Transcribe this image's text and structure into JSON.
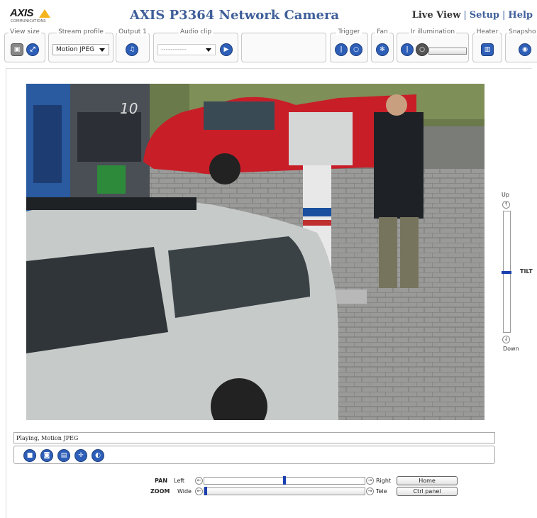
{
  "header": {
    "logo_text": "AXIS",
    "logo_sub": "COMMUNICATIONS",
    "title": "AXIS P3364 Network Camera",
    "nav": [
      "Live View",
      "Setup",
      "Help"
    ]
  },
  "toolbar": {
    "view_size_label": "View size",
    "stream_profile_label": "Stream profile",
    "stream_profile_value": "Motion JPEG",
    "output_label": "Output 1",
    "audio_clip_label": "Audio clip",
    "audio_clip_value": "-----------",
    "trigger_label": "Trigger",
    "fan_label": "Fan",
    "ir_label": "Ir illumination",
    "heater_label": "Heater",
    "snapshot_label": "Snapsho"
  },
  "tilt": {
    "up_label": "Up",
    "down_label": "Down",
    "label": "TILT",
    "level": 0.51
  },
  "status_text": "Playing, Motion JPEG",
  "ptz": {
    "pan_label": "PAN",
    "pan_left": "Left",
    "pan_right": "Right",
    "pan_level": 0.5,
    "zoom_label": "ZOOM",
    "zoom_wide": "Wide",
    "zoom_tele": "Tele",
    "zoom_level": 0.0,
    "home_button": "Home",
    "ctrl_panel_button": "Ctrl panel"
  },
  "colors": {
    "title_blue": "#3f5f9a",
    "icon_blue": "#2d5fb8",
    "slider_thumb": "#1a3fb0"
  }
}
